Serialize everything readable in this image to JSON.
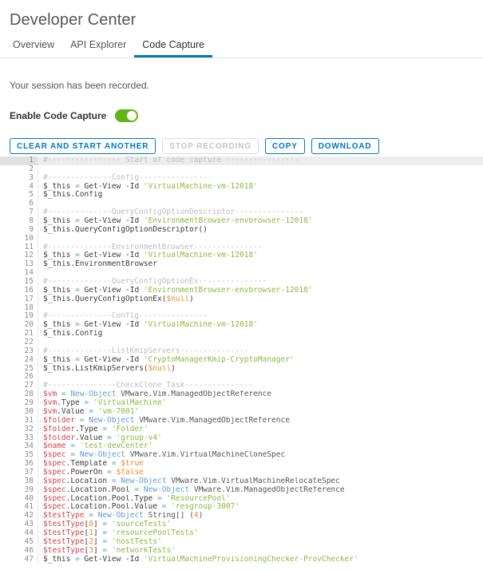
{
  "header": {
    "title": "Developer Center"
  },
  "tabs": [
    {
      "label": "Overview",
      "active": false
    },
    {
      "label": "API Explorer",
      "active": false
    },
    {
      "label": "Code Capture",
      "active": true
    }
  ],
  "session": {
    "message": "Your session has been recorded."
  },
  "toggle": {
    "label": "Enable Code Capture",
    "state": "on",
    "on_color": "#60b515"
  },
  "buttons": [
    {
      "label": "CLEAR AND START ANOTHER",
      "disabled": false,
      "name": "clear-and-start-another-button"
    },
    {
      "label": "STOP RECORDING",
      "disabled": true,
      "name": "stop-recording-button"
    },
    {
      "label": "COPY",
      "disabled": false,
      "name": "copy-button"
    },
    {
      "label": "DOWNLOAD",
      "disabled": false,
      "name": "download-button"
    }
  ],
  "accent_color": "#0079b8",
  "code": {
    "language": "powershell",
    "highlighted_line": 1,
    "first_line": 1,
    "last_visible_line": 47,
    "lines": [
      {
        "n": 1,
        "tokens": [
          {
            "t": "cmt",
            "v": "#---------------- Start of code capture ----------------"
          }
        ]
      },
      {
        "n": 2,
        "tokens": []
      },
      {
        "n": 3,
        "tokens": [
          {
            "t": "cmt",
            "v": "#--------------Config---------------"
          }
        ]
      },
      {
        "n": 4,
        "tokens": [
          {
            "t": "this",
            "v": "$_this"
          },
          {
            "t": "plain",
            "v": " "
          },
          {
            "t": "op",
            "v": "="
          },
          {
            "t": "plain",
            "v": " "
          },
          {
            "t": "cmd",
            "v": "Get-View -Id "
          },
          {
            "t": "str",
            "v": "'VirtualMachine-vm-12018'"
          }
        ]
      },
      {
        "n": 5,
        "tokens": [
          {
            "t": "this",
            "v": "$_this.Config"
          }
        ]
      },
      {
        "n": 6,
        "tokens": []
      },
      {
        "n": 7,
        "tokens": [
          {
            "t": "cmt",
            "v": "#--------------QueryConfigOptionDescriptor---------------"
          }
        ]
      },
      {
        "n": 8,
        "tokens": [
          {
            "t": "this",
            "v": "$_this"
          },
          {
            "t": "plain",
            "v": " "
          },
          {
            "t": "op",
            "v": "="
          },
          {
            "t": "plain",
            "v": " "
          },
          {
            "t": "cmd",
            "v": "Get-View -Id "
          },
          {
            "t": "str",
            "v": "'EnvironmentBrowser-envbrowser-12018'"
          }
        ]
      },
      {
        "n": 9,
        "tokens": [
          {
            "t": "this",
            "v": "$_this.QueryConfigOptionDescriptor()"
          }
        ]
      },
      {
        "n": 10,
        "tokens": []
      },
      {
        "n": 11,
        "tokens": [
          {
            "t": "cmt",
            "v": "#--------------EnvironmentBrowser---------------"
          }
        ]
      },
      {
        "n": 12,
        "tokens": [
          {
            "t": "this",
            "v": "$_this"
          },
          {
            "t": "plain",
            "v": " "
          },
          {
            "t": "op",
            "v": "="
          },
          {
            "t": "plain",
            "v": " "
          },
          {
            "t": "cmd",
            "v": "Get-View -Id "
          },
          {
            "t": "str",
            "v": "'VirtualMachine-vm-12018'"
          }
        ]
      },
      {
        "n": 13,
        "tokens": [
          {
            "t": "this",
            "v": "$_this.EnvironmentBrowser"
          }
        ]
      },
      {
        "n": 14,
        "tokens": []
      },
      {
        "n": 15,
        "tokens": [
          {
            "t": "cmt",
            "v": "#--------------QueryConfigOptionEx---------------"
          }
        ]
      },
      {
        "n": 16,
        "tokens": [
          {
            "t": "this",
            "v": "$_this"
          },
          {
            "t": "plain",
            "v": " "
          },
          {
            "t": "op",
            "v": "="
          },
          {
            "t": "plain",
            "v": " "
          },
          {
            "t": "cmd",
            "v": "Get-View -Id "
          },
          {
            "t": "str",
            "v": "'EnvironmentBrowser-envbrowser-12018'"
          }
        ]
      },
      {
        "n": 17,
        "tokens": [
          {
            "t": "this",
            "v": "$_this.QueryConfigOptionEx("
          },
          {
            "t": "const",
            "v": "$null"
          },
          {
            "t": "this",
            "v": ")"
          }
        ]
      },
      {
        "n": 18,
        "tokens": []
      },
      {
        "n": 19,
        "tokens": [
          {
            "t": "cmt",
            "v": "#--------------Config---------------"
          }
        ]
      },
      {
        "n": 20,
        "tokens": [
          {
            "t": "this",
            "v": "$_this"
          },
          {
            "t": "plain",
            "v": " "
          },
          {
            "t": "op",
            "v": "="
          },
          {
            "t": "plain",
            "v": " "
          },
          {
            "t": "cmd",
            "v": "Get-View -Id "
          },
          {
            "t": "str",
            "v": "'VirtualMachine-vm-12018'"
          }
        ]
      },
      {
        "n": 21,
        "tokens": [
          {
            "t": "this",
            "v": "$_this.Config"
          }
        ]
      },
      {
        "n": 22,
        "tokens": []
      },
      {
        "n": 23,
        "tokens": [
          {
            "t": "cmt",
            "v": "#--------------ListKmipServers---------------"
          }
        ]
      },
      {
        "n": 24,
        "tokens": [
          {
            "t": "this",
            "v": "$_this"
          },
          {
            "t": "plain",
            "v": " "
          },
          {
            "t": "op",
            "v": "="
          },
          {
            "t": "plain",
            "v": " "
          },
          {
            "t": "cmd",
            "v": "Get-View -Id "
          },
          {
            "t": "str",
            "v": "'CryptoManagerKmip-CryptoManager'"
          }
        ]
      },
      {
        "n": 25,
        "tokens": [
          {
            "t": "this",
            "v": "$_this.ListKmipServers("
          },
          {
            "t": "const",
            "v": "$null"
          },
          {
            "t": "this",
            "v": ")"
          }
        ]
      },
      {
        "n": 26,
        "tokens": []
      },
      {
        "n": 27,
        "tokens": [
          {
            "t": "cmt",
            "v": "#---------------CheckClone_Task---------------"
          }
        ]
      },
      {
        "n": 28,
        "tokens": [
          {
            "t": "var",
            "v": "$vm"
          },
          {
            "t": "plain",
            "v": " "
          },
          {
            "t": "op",
            "v": "="
          },
          {
            "t": "plain",
            "v": " "
          },
          {
            "t": "kw",
            "v": "New-Object"
          },
          {
            "t": "plain",
            "v": " "
          },
          {
            "t": "type",
            "v": "VMware.Vim.ManagedObjectReference"
          }
        ]
      },
      {
        "n": 29,
        "tokens": [
          {
            "t": "var",
            "v": "$vm"
          },
          {
            "t": "prop",
            "v": ".Type"
          },
          {
            "t": "plain",
            "v": " "
          },
          {
            "t": "op",
            "v": "="
          },
          {
            "t": "plain",
            "v": " "
          },
          {
            "t": "str",
            "v": "'VirtualMachine'"
          }
        ]
      },
      {
        "n": 30,
        "tokens": [
          {
            "t": "var",
            "v": "$vm"
          },
          {
            "t": "prop",
            "v": ".Value"
          },
          {
            "t": "plain",
            "v": " "
          },
          {
            "t": "op",
            "v": "="
          },
          {
            "t": "plain",
            "v": " "
          },
          {
            "t": "str",
            "v": "'vm-7001'"
          }
        ]
      },
      {
        "n": 31,
        "tokens": [
          {
            "t": "var",
            "v": "$folder"
          },
          {
            "t": "plain",
            "v": " "
          },
          {
            "t": "op",
            "v": "="
          },
          {
            "t": "plain",
            "v": " "
          },
          {
            "t": "kw",
            "v": "New-Object"
          },
          {
            "t": "plain",
            "v": " "
          },
          {
            "t": "type",
            "v": "VMware.Vim.ManagedObjectReference"
          }
        ]
      },
      {
        "n": 32,
        "tokens": [
          {
            "t": "var",
            "v": "$folder"
          },
          {
            "t": "prop",
            "v": ".Type"
          },
          {
            "t": "plain",
            "v": " "
          },
          {
            "t": "op",
            "v": "="
          },
          {
            "t": "plain",
            "v": " "
          },
          {
            "t": "str",
            "v": "'Folder'"
          }
        ]
      },
      {
        "n": 33,
        "tokens": [
          {
            "t": "var",
            "v": "$folder"
          },
          {
            "t": "prop",
            "v": ".Value"
          },
          {
            "t": "plain",
            "v": " "
          },
          {
            "t": "op",
            "v": "="
          },
          {
            "t": "plain",
            "v": " "
          },
          {
            "t": "str",
            "v": "'group-v4'"
          }
        ]
      },
      {
        "n": 34,
        "tokens": [
          {
            "t": "var",
            "v": "$name"
          },
          {
            "t": "plain",
            "v": " "
          },
          {
            "t": "op",
            "v": "="
          },
          {
            "t": "plain",
            "v": " "
          },
          {
            "t": "str",
            "v": "'test-devCenter'"
          }
        ]
      },
      {
        "n": 35,
        "tokens": [
          {
            "t": "var",
            "v": "$spec"
          },
          {
            "t": "plain",
            "v": " "
          },
          {
            "t": "op",
            "v": "="
          },
          {
            "t": "plain",
            "v": " "
          },
          {
            "t": "kw",
            "v": "New-Object"
          },
          {
            "t": "plain",
            "v": " "
          },
          {
            "t": "type",
            "v": "VMware.Vim.VirtualMachineCloneSpec"
          }
        ]
      },
      {
        "n": 36,
        "tokens": [
          {
            "t": "var",
            "v": "$spec"
          },
          {
            "t": "prop",
            "v": ".Template"
          },
          {
            "t": "plain",
            "v": " "
          },
          {
            "t": "op",
            "v": "="
          },
          {
            "t": "plain",
            "v": " "
          },
          {
            "t": "const",
            "v": "$true"
          }
        ]
      },
      {
        "n": 37,
        "tokens": [
          {
            "t": "var",
            "v": "$spec"
          },
          {
            "t": "prop",
            "v": ".PowerOn"
          },
          {
            "t": "plain",
            "v": " "
          },
          {
            "t": "op",
            "v": "="
          },
          {
            "t": "plain",
            "v": " "
          },
          {
            "t": "const",
            "v": "$false"
          }
        ]
      },
      {
        "n": 38,
        "tokens": [
          {
            "t": "var",
            "v": "$spec"
          },
          {
            "t": "prop",
            "v": ".Location"
          },
          {
            "t": "plain",
            "v": " "
          },
          {
            "t": "op",
            "v": "="
          },
          {
            "t": "plain",
            "v": " "
          },
          {
            "t": "kw",
            "v": "New-Object"
          },
          {
            "t": "plain",
            "v": " "
          },
          {
            "t": "type",
            "v": "VMware.Vim.VirtualMachineRelocateSpec"
          }
        ]
      },
      {
        "n": 39,
        "tokens": [
          {
            "t": "var",
            "v": "$spec"
          },
          {
            "t": "prop",
            "v": ".Location.Pool"
          },
          {
            "t": "plain",
            "v": " "
          },
          {
            "t": "op",
            "v": "="
          },
          {
            "t": "plain",
            "v": " "
          },
          {
            "t": "kw",
            "v": "New-Object"
          },
          {
            "t": "plain",
            "v": " "
          },
          {
            "t": "type",
            "v": "VMware.Vim.ManagedObjectReference"
          }
        ]
      },
      {
        "n": 40,
        "tokens": [
          {
            "t": "var",
            "v": "$spec"
          },
          {
            "t": "prop",
            "v": ".Location.Pool.Type"
          },
          {
            "t": "plain",
            "v": " "
          },
          {
            "t": "op",
            "v": "="
          },
          {
            "t": "plain",
            "v": " "
          },
          {
            "t": "str",
            "v": "'ResourcePool'"
          }
        ]
      },
      {
        "n": 41,
        "tokens": [
          {
            "t": "var",
            "v": "$spec"
          },
          {
            "t": "prop",
            "v": ".Location.Pool.Value"
          },
          {
            "t": "plain",
            "v": " "
          },
          {
            "t": "op",
            "v": "="
          },
          {
            "t": "plain",
            "v": " "
          },
          {
            "t": "str",
            "v": "'resgroup-3007'"
          }
        ]
      },
      {
        "n": 42,
        "tokens": [
          {
            "t": "var",
            "v": "$testType"
          },
          {
            "t": "plain",
            "v": " "
          },
          {
            "t": "op",
            "v": "="
          },
          {
            "t": "plain",
            "v": " "
          },
          {
            "t": "kw",
            "v": "New-Object"
          },
          {
            "t": "plain",
            "v": " "
          },
          {
            "t": "type",
            "v": "String[] ("
          },
          {
            "t": "num",
            "v": "4"
          },
          {
            "t": "type",
            "v": ")"
          }
        ]
      },
      {
        "n": 43,
        "tokens": [
          {
            "t": "var",
            "v": "$testType"
          },
          {
            "t": "prop",
            "v": "["
          },
          {
            "t": "num",
            "v": "0"
          },
          {
            "t": "prop",
            "v": "]"
          },
          {
            "t": "plain",
            "v": " "
          },
          {
            "t": "op",
            "v": "="
          },
          {
            "t": "plain",
            "v": " "
          },
          {
            "t": "str",
            "v": "'sourceTests'"
          }
        ]
      },
      {
        "n": 44,
        "tokens": [
          {
            "t": "var",
            "v": "$testType"
          },
          {
            "t": "prop",
            "v": "["
          },
          {
            "t": "num",
            "v": "1"
          },
          {
            "t": "prop",
            "v": "]"
          },
          {
            "t": "plain",
            "v": " "
          },
          {
            "t": "op",
            "v": "="
          },
          {
            "t": "plain",
            "v": " "
          },
          {
            "t": "str",
            "v": "'resourcePoolTests'"
          }
        ]
      },
      {
        "n": 45,
        "tokens": [
          {
            "t": "var",
            "v": "$testType"
          },
          {
            "t": "prop",
            "v": "["
          },
          {
            "t": "num",
            "v": "2"
          },
          {
            "t": "prop",
            "v": "]"
          },
          {
            "t": "plain",
            "v": " "
          },
          {
            "t": "op",
            "v": "="
          },
          {
            "t": "plain",
            "v": " "
          },
          {
            "t": "str",
            "v": "'hostTests'"
          }
        ]
      },
      {
        "n": 46,
        "tokens": [
          {
            "t": "var",
            "v": "$testType"
          },
          {
            "t": "prop",
            "v": "["
          },
          {
            "t": "num",
            "v": "3"
          },
          {
            "t": "prop",
            "v": "]"
          },
          {
            "t": "plain",
            "v": " "
          },
          {
            "t": "op",
            "v": "="
          },
          {
            "t": "plain",
            "v": " "
          },
          {
            "t": "str",
            "v": "'networkTests'"
          }
        ]
      },
      {
        "n": 47,
        "tokens": [
          {
            "t": "this",
            "v": "$_this"
          },
          {
            "t": "plain",
            "v": " "
          },
          {
            "t": "op",
            "v": "="
          },
          {
            "t": "plain",
            "v": " "
          },
          {
            "t": "cmd",
            "v": "Get-View -Id "
          },
          {
            "t": "str",
            "v": "'VirtualMachineProvisioningChecker-ProvChecker'"
          }
        ]
      }
    ]
  }
}
